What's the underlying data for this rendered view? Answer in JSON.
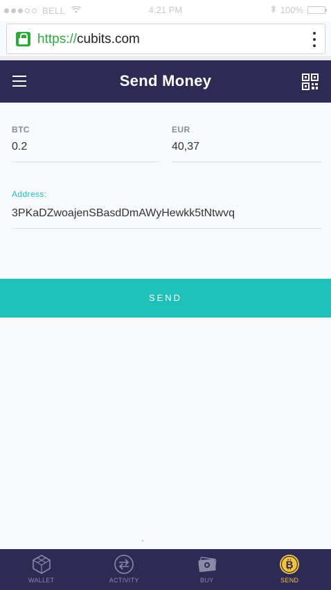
{
  "status_bar": {
    "carrier": "BELL",
    "time": "4:21 PM",
    "battery": "100%"
  },
  "browser": {
    "url_scheme": "https://",
    "url_host": "cubits.com"
  },
  "header": {
    "title": "Send Money"
  },
  "form": {
    "btc_label": "BTC",
    "btc_value": "0.2",
    "eur_label": "EUR",
    "eur_value": "40,37",
    "address_label": "Address:",
    "address_value": "3PKaDZwoajenSBasdDmAWyHewkk5tNtwvq"
  },
  "send_button": {
    "label": "SEND"
  },
  "tabs": [
    {
      "label": "WALLET",
      "icon": "wallet-cube-icon"
    },
    {
      "label": "ACTIVITY",
      "icon": "activity-arrows-icon"
    },
    {
      "label": "BUY",
      "icon": "buy-cash-icon"
    },
    {
      "label": "SEND",
      "icon": "bitcoin-icon",
      "active": true
    }
  ],
  "colors": {
    "header_bg": "#2d2b54",
    "accent_teal": "#1fc0b9",
    "active_tab": "#f2c33c",
    "secure_green": "#2eaa3c"
  }
}
